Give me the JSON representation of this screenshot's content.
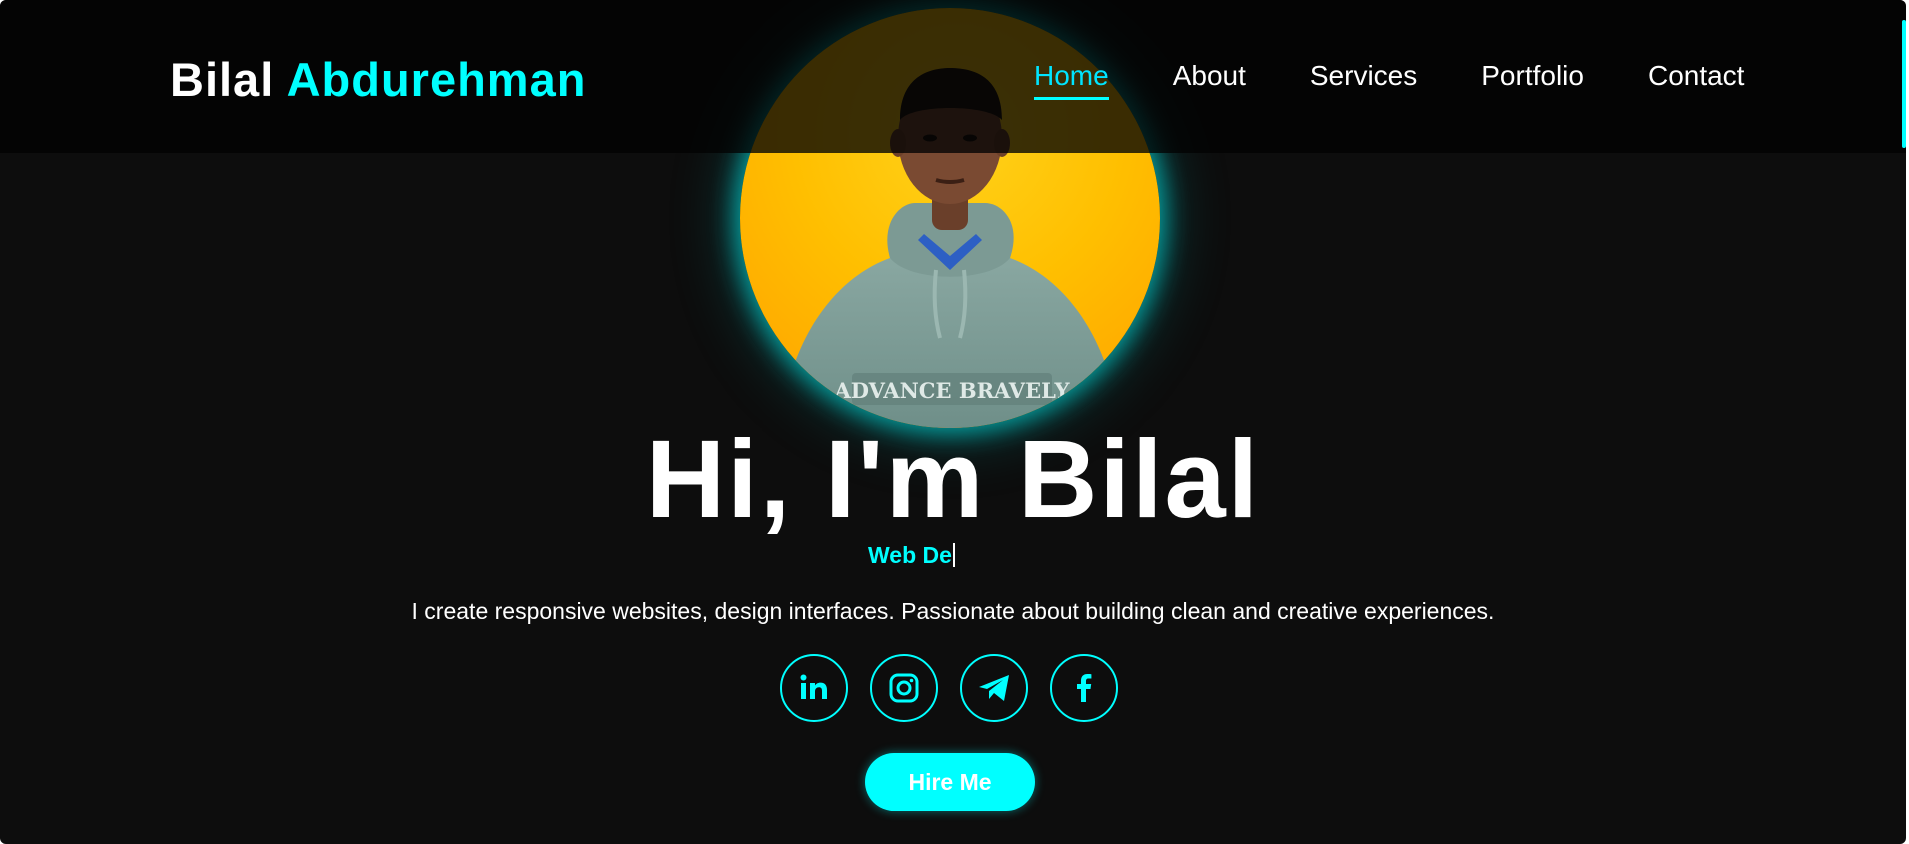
{
  "header": {
    "logo_first": "Bilal",
    "logo_second": "Abdurehman",
    "nav": [
      {
        "label": "Home",
        "active": true
      },
      {
        "label": "About",
        "active": false
      },
      {
        "label": "Services",
        "active": false
      },
      {
        "label": "Portfolio",
        "active": false
      },
      {
        "label": "Contact",
        "active": false
      }
    ]
  },
  "hero": {
    "profile_image": "portrait-photo",
    "profile_shirt_text": "ADVANCE BRAVELY",
    "title": "Hi, I'm Bilal",
    "typed_subtitle": "Web De",
    "description": "I create responsive websites, design interfaces. Passionate about building clean and creative experiences.",
    "socials": [
      {
        "name": "LinkedIn",
        "icon": "linkedin-icon"
      },
      {
        "name": "Instagram",
        "icon": "instagram-icon"
      },
      {
        "name": "Telegram",
        "icon": "telegram-icon"
      },
      {
        "name": "Facebook",
        "icon": "facebook-icon"
      }
    ],
    "cta_label": "Hire Me"
  },
  "colors": {
    "accent": "#00ffff",
    "background": "#0d0d0d",
    "header_background": "#030303",
    "text": "#ffffff",
    "profile_background": "#ffbf00"
  }
}
